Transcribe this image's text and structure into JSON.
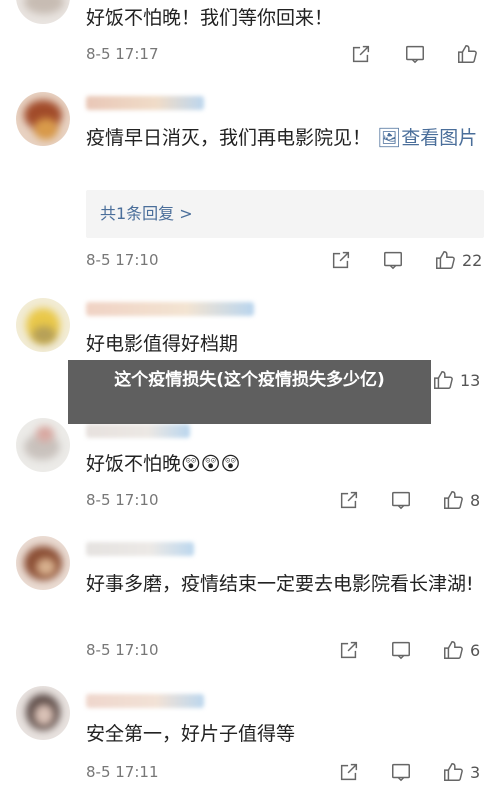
{
  "overlay_title": "这个疫情损失(这个疫情损失多少亿)",
  "comments": [
    {
      "text": "好饭不怕晚！我们等你回来！",
      "time": "8-5 17:17",
      "likes": ""
    },
    {
      "text": "疫情早日消灭，我们再电影院见！",
      "link": "查看图片",
      "reply": "共1条回复 >",
      "time": "8-5 17:10",
      "likes": "22"
    },
    {
      "text": "好电影值得好档期",
      "time": "",
      "likes": "13"
    },
    {
      "text": "好饭不怕晚😲😲😲",
      "time": "8-5 17:10",
      "likes": "8"
    },
    {
      "text": "好事多磨，疫情结束一定要去电影院看长津湖!",
      "time": "8-5 17:10",
      "likes": "6"
    },
    {
      "text": "安全第一，好片子值得等",
      "time": "8-5 17:11",
      "likes": "3"
    }
  ],
  "colors": {
    "link": "#4a6e9a",
    "overlay_bg": "#3c3c3c"
  },
  "icons": {
    "share": "share-icon",
    "comment": "comment-icon",
    "like": "like-icon"
  }
}
